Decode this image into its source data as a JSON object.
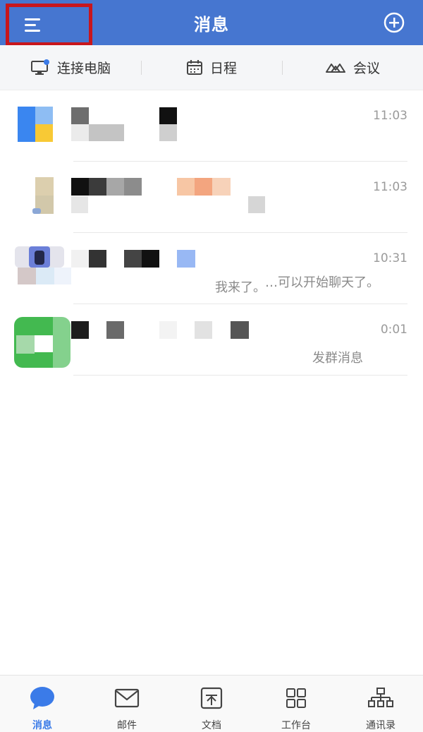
{
  "header": {
    "title": "消息"
  },
  "quickbar": {
    "items": [
      {
        "label": "连接电脑",
        "icon": "monitor-icon"
      },
      {
        "label": "日程",
        "icon": "calendar-icon"
      },
      {
        "label": "会议",
        "icon": "meeting-icon"
      }
    ]
  },
  "messages": [
    {
      "time": "11:03",
      "preview": ""
    },
    {
      "time": "11:03",
      "preview": "…可以开始聊天了。"
    },
    {
      "time": "10:31",
      "preview": "我来了。"
    },
    {
      "time": "0:01",
      "preview": "发群消息"
    }
  ],
  "tabs": [
    {
      "label": "消息",
      "icon": "chat-bubble-icon",
      "active": true
    },
    {
      "label": "邮件",
      "icon": "mail-icon",
      "active": false
    },
    {
      "label": "文档",
      "icon": "document-icon",
      "active": false
    },
    {
      "label": "工作台",
      "icon": "grid-icon",
      "active": false
    },
    {
      "label": "通讯录",
      "icon": "org-chart-icon",
      "active": false
    }
  ],
  "colors": {
    "header": "#4676d0",
    "accent": "#3b7be8",
    "highlight": "#c8161c"
  }
}
